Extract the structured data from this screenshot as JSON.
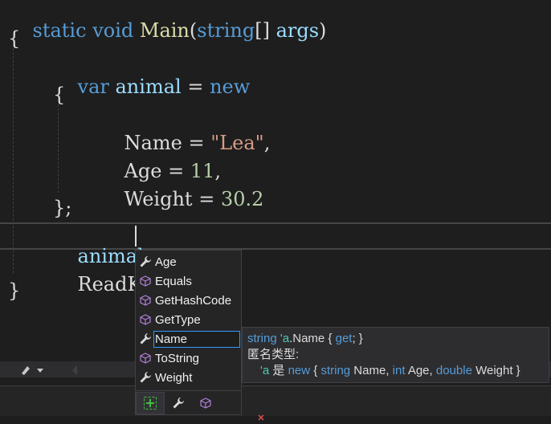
{
  "code": {
    "line1": {
      "kw1": "static",
      "kw2": "void",
      "method": "Main",
      "paren_open": "(",
      "type": "string",
      "brackets": "[]",
      "param": "args",
      "paren_close": ")"
    },
    "line2": "{",
    "line3": {
      "kw": "var",
      "ident": "animal",
      "eq": "=",
      "kw_new": "new"
    },
    "line4": "{",
    "line5": {
      "prop": "Name",
      "eq": "=",
      "str": "\"Lea\"",
      "comma": ","
    },
    "line6": {
      "prop": "Age",
      "eq": "=",
      "num": "11",
      "comma": ","
    },
    "line7": {
      "prop": "Weight",
      "eq": "=",
      "num": "30.2"
    },
    "line8": "};",
    "line9": {
      "ident": "animal",
      "dot": "."
    },
    "line10": {
      "text": "ReadKey"
    },
    "line11": "}"
  },
  "completion": {
    "items": [
      {
        "label": "Age",
        "icon": "wrench-icon"
      },
      {
        "label": "Equals",
        "icon": "cube-icon"
      },
      {
        "label": "GetHashCode",
        "icon": "cube-icon"
      },
      {
        "label": "GetType",
        "icon": "cube-icon"
      },
      {
        "label": "Name",
        "icon": "wrench-icon",
        "selected": true
      },
      {
        "label": "ToString",
        "icon": "cube-icon"
      },
      {
        "label": "Weight",
        "icon": "wrench-icon"
      }
    ],
    "filters": [
      "add-filter-icon",
      "wrench-filter-icon",
      "cube-filter-icon"
    ]
  },
  "tooltip": {
    "l1_type": "string",
    "l1_anon": "'a",
    "l1_rest": ".Name { ",
    "l1_get": "get",
    "l1_end": "; }",
    "l2": "匿名类型:",
    "l3_a": "'a",
    "l3_is": " 是 ",
    "l3_new": "new",
    "l3_brace": " { ",
    "l3_t1": "string",
    "l3_n1": " Name, ",
    "l3_t2": "int",
    "l3_n2": " Age, ",
    "l3_t3": "double",
    "l3_n3": " Weight }"
  },
  "colors": {
    "keyword": "#569cd6",
    "type": "#4ec9b0",
    "identifier": "#9cdcfe",
    "method": "#dcdcaa",
    "string": "#d69d85",
    "number": "#b5cea8",
    "selection_border": "#3399ff"
  }
}
